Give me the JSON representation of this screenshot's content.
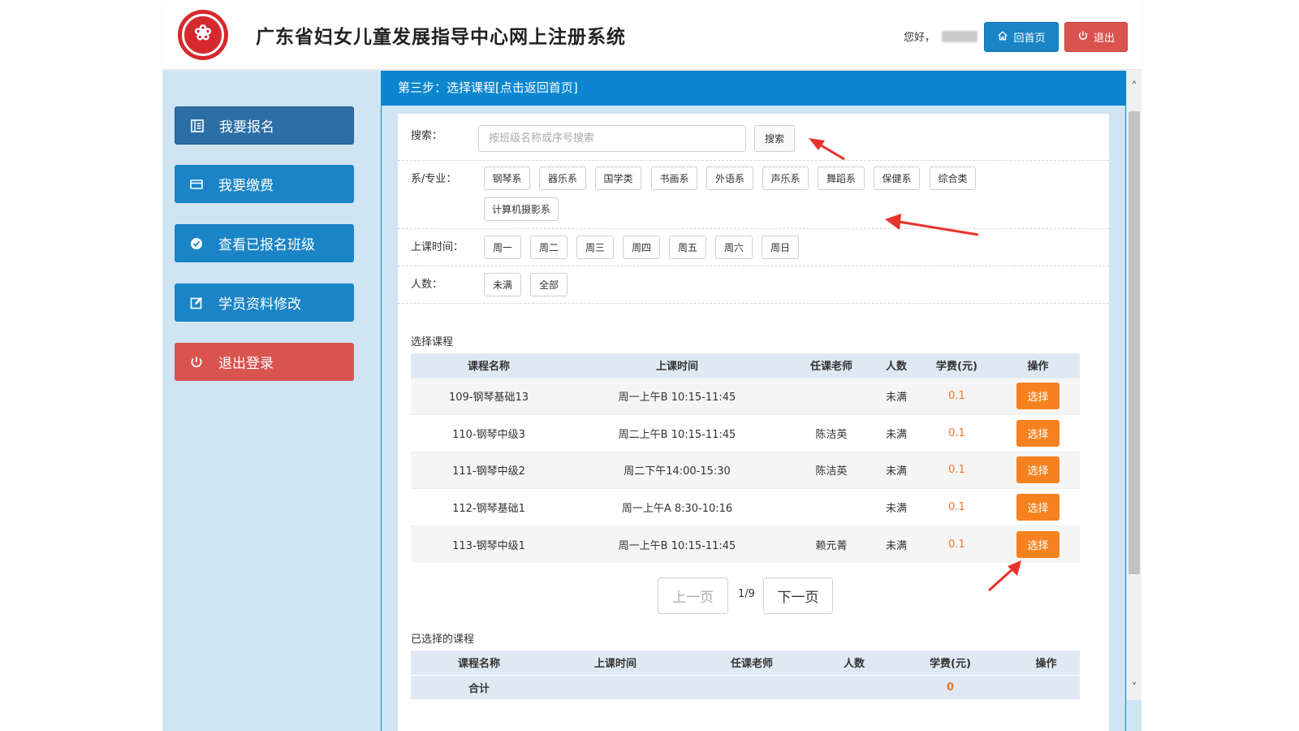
{
  "header": {
    "site_title": "广东省妇女儿童发展指导中心网上注册系统",
    "greeting": "您好，",
    "home_label": "回首页",
    "logout_label": "退出"
  },
  "sidebar": {
    "items": [
      {
        "label": "我要报名",
        "icon": "register-icon"
      },
      {
        "label": "我要缴费",
        "icon": "card-icon"
      },
      {
        "label": "查看已报名班级",
        "icon": "check-circle-icon"
      },
      {
        "label": "学员资料修改",
        "icon": "edit-icon"
      },
      {
        "label": "退出登录",
        "icon": "power-icon"
      }
    ]
  },
  "panel": {
    "title": "第三步：选择课程[点击返回首页]"
  },
  "filters": {
    "search_label": "搜索：",
    "search_placeholder": "按班级名称或序号搜索",
    "search_button": "搜索",
    "dept_label": "系/专业：",
    "depts": [
      "钢琴系",
      "器乐系",
      "国学类",
      "书画系",
      "外语系",
      "声乐系",
      "舞蹈系",
      "保健系",
      "综合类",
      "计算机摄影系"
    ],
    "time_label": "上课时间：",
    "days": [
      "周一",
      "周二",
      "周三",
      "周四",
      "周五",
      "周六",
      "周日"
    ],
    "size_label": "人数：",
    "sizes": [
      "未满",
      "全部"
    ]
  },
  "courses": {
    "section_label": "选择课程",
    "headers": [
      "课程名称",
      "上课时间",
      "任课老师",
      "人数",
      "学费(元)",
      "操作"
    ],
    "rows": [
      {
        "name": "109-钢琴基础13",
        "time": "周一上午B 10:15-11:45",
        "teacher": "",
        "size": "未满",
        "fee": "0.1",
        "action": "选择"
      },
      {
        "name": "110-钢琴中级3",
        "time": "周二上午B 10:15-11:45",
        "teacher": "陈洁英",
        "size": "未满",
        "fee": "0.1",
        "action": "选择"
      },
      {
        "name": "111-钢琴中级2",
        "time": "周二下午14:00-15:30",
        "teacher": "陈洁英",
        "size": "未满",
        "fee": "0.1",
        "action": "选择"
      },
      {
        "name": "112-钢琴基础1",
        "time": "周一上午A 8:30-10:16",
        "teacher": "",
        "size": "未满",
        "fee": "0.1",
        "action": "选择"
      },
      {
        "name": "113-钢琴中级1",
        "time": "周一上午B 10:15-11:45",
        "teacher": "赖元菁",
        "size": "未满",
        "fee": "0.1",
        "action": "选择"
      }
    ]
  },
  "pagination": {
    "prev_label": "上一页",
    "page": "1/9",
    "next_label": "下一页"
  },
  "chosen": {
    "section_label": "已选择的课程",
    "headers": [
      "课程名称",
      "上课时间",
      "任课老师",
      "人数",
      "学费(元)",
      "操作"
    ],
    "total_label": "合计",
    "total_fee": "0"
  },
  "colors": {
    "primary": "#1a84c6",
    "danger": "#d9534f",
    "accent": "#f5821f",
    "sidebar_bg": "#cfe5f4",
    "arrow": "#e8322d"
  }
}
